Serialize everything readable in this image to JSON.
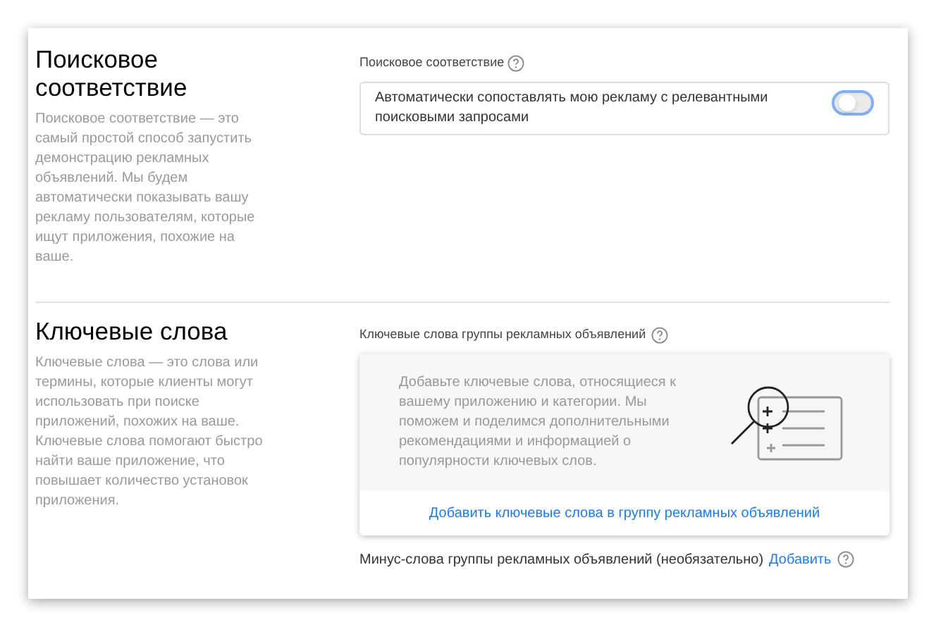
{
  "sections": [
    {
      "kind": "toggle",
      "title": "Поисковое соответствие",
      "description": "Поисковое соответствие — это самый простой способ запустить демонстрацию рекламных объявлений. Мы будем автоматически показывать вашу рекламу пользователям, которые ищут приложения, похожие на ваше.",
      "field_label": "Поисковое соответствие",
      "option": {
        "label": "Автоматически сопоставлять мою рекламу с релевантными поисковыми запросами",
        "on": false
      }
    },
    {
      "kind": "keywords",
      "title": "Ключевые слова",
      "description": "Ключевые слова — это слова или термины, которые клиенты могут использовать при поиске приложений, похожих на ваше. Ключевые слова помогают быстро найти ваше приложение, что повышает количество установок приложения.",
      "field_label": "Ключевые слова группы рекламных объявлений",
      "empty_text": "Добавьте ключевые слова, относящиеся к вашему приложению и категории. Мы поможем и поделимся дополнительными рекомендациями и информацией о популярности ключевых слов.",
      "add_link": "Добавить ключевые слова в группу рекламных объявлений",
      "negative_label": "Минус-слова группы рекламных объявлений (необязательно)",
      "negative_link": "Добавить"
    }
  ]
}
